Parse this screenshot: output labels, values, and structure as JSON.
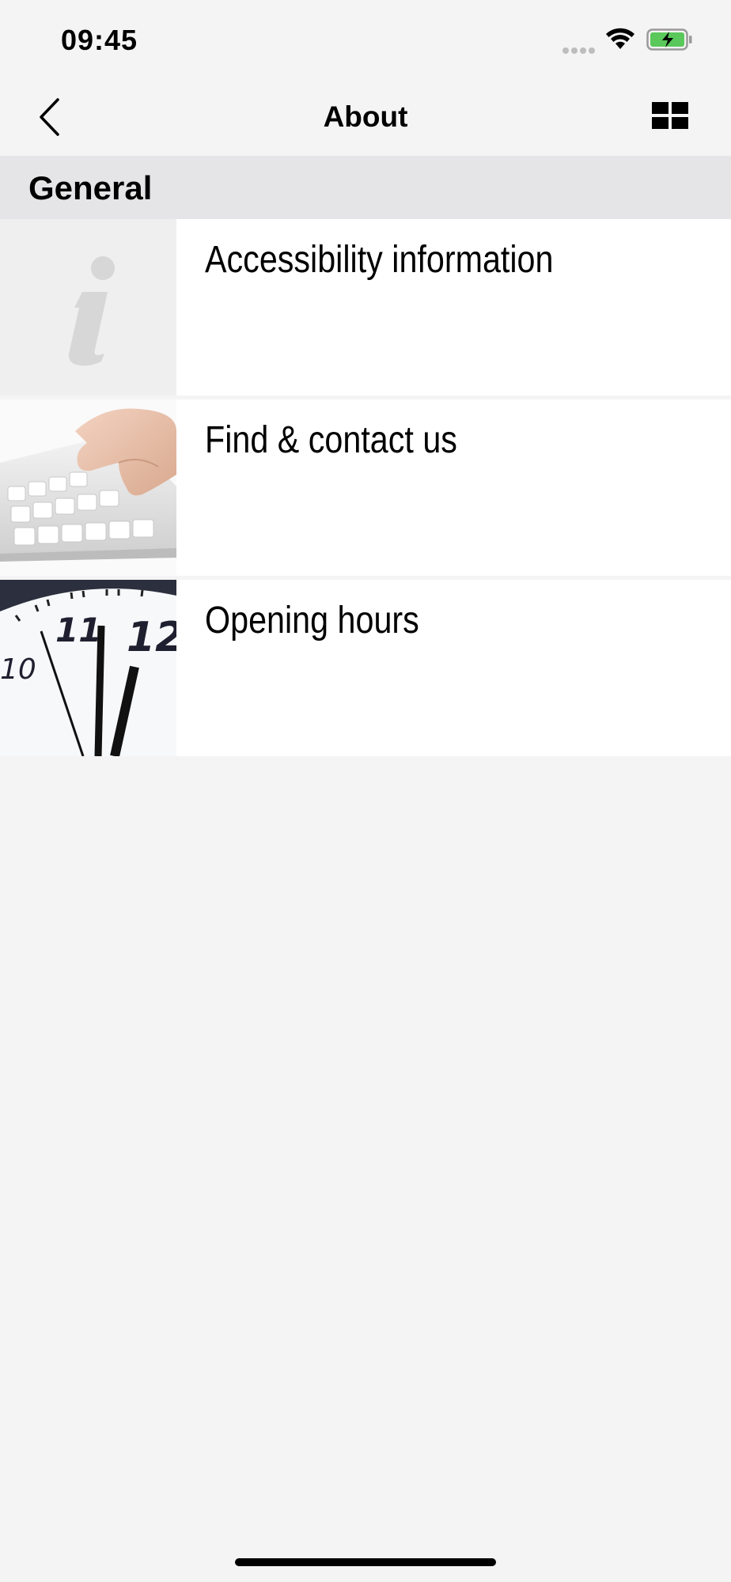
{
  "status_bar": {
    "time": "09:45"
  },
  "nav": {
    "title": "About",
    "back_icon": "chevron-left-icon",
    "menu_icon": "grid-icon"
  },
  "section": {
    "title": "General"
  },
  "items": [
    {
      "label": "Accessibility information",
      "thumbnail": "info-icon"
    },
    {
      "label": "Find & contact us",
      "thumbnail": "keyboard-hands-image"
    },
    {
      "label": "Opening hours",
      "thumbnail": "clock-image"
    }
  ],
  "colors": {
    "background": "#f4f4f4",
    "section_header": "#e5e5e7",
    "battery_fill": "#5ac85a"
  }
}
